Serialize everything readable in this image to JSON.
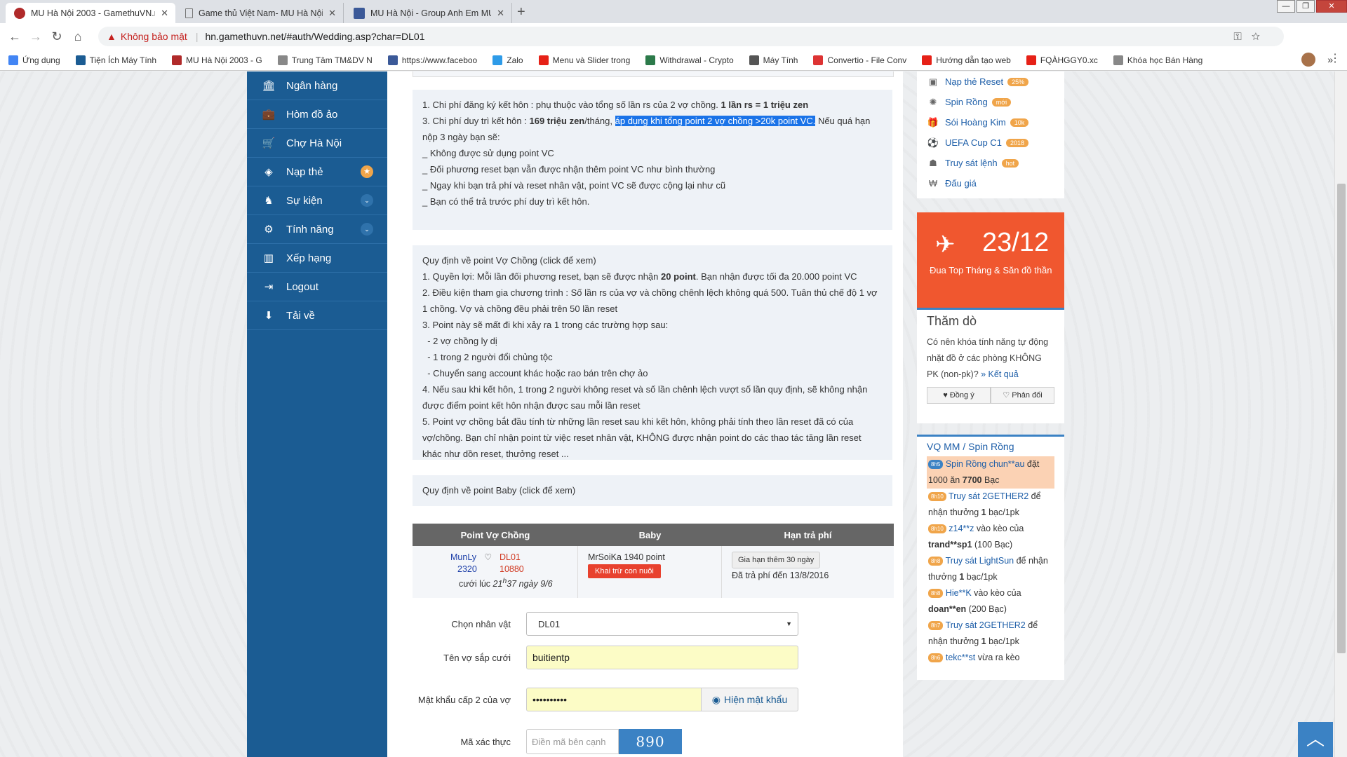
{
  "tabs": [
    {
      "title": "MU Hà Nội 2003 - GamethuVN.n"
    },
    {
      "title": "Game thủ Việt Nam- MU Hà Nội"
    },
    {
      "title": "MU Hà Nội - Group Anh Em MU"
    }
  ],
  "window_controls": [
    "—",
    "❐",
    "✕"
  ],
  "omnibox": {
    "warning": "Không bảo mật",
    "url": "hn.gamethuvn.net/#auth/Wedding.asp?char=DL01"
  },
  "bookmarks": [
    {
      "label": "Ứng dụng",
      "color": "#4285f4"
    },
    {
      "label": "Tiện Ích Máy Tính",
      "color": "#1b5c93"
    },
    {
      "label": "MU Hà Nội 2003 - G",
      "color": "#b02a2a"
    },
    {
      "label": "Trung Tâm TM&DV N",
      "color": "#888888"
    },
    {
      "label": "https://www.faceboo",
      "color": "#3b5998"
    },
    {
      "label": "Zalo",
      "color": "#2e9be8"
    },
    {
      "label": "Menu và Slider trong",
      "color": "#e62117"
    },
    {
      "label": "Withdrawal - Crypto",
      "color": "#2c7a4a"
    },
    {
      "label": "Máy Tính",
      "color": "#555555"
    },
    {
      "label": "Convertio - File Conv",
      "color": "#d33"
    },
    {
      "label": "Hướng dẫn tạo web",
      "color": "#e62117"
    },
    {
      "label": "FQÀHGGY0.xc",
      "color": "#e62117"
    },
    {
      "label": "Khóa học Bán Hàng",
      "color": "#888888"
    }
  ],
  "sidebar": [
    {
      "label": "Ngân hàng",
      "icon": "🏛"
    },
    {
      "label": "Hòm đồ ảo",
      "icon": "💼"
    },
    {
      "label": "Chợ Hà Nội",
      "icon": "🛒"
    },
    {
      "label": "Nạp thẻ",
      "icon": "◈",
      "badge": "★"
    },
    {
      "label": "Sự kiện",
      "icon": "♞",
      "chev": "⌄"
    },
    {
      "label": "Tính năng",
      "icon": "⚙",
      "chev": "⌄"
    },
    {
      "label": "Xếp hạng",
      "icon": "▥"
    },
    {
      "label": "Logout",
      "icon": "⇥"
    },
    {
      "label": "Tải về",
      "icon": "⬇"
    }
  ],
  "costs": {
    "l1_a": "1. Chi phí đăng ký kết hôn : phụ thuộc vào tổng số lần rs của 2 vợ chồng. ",
    "l1_b": "1 lần rs = 1 triệu zen",
    "l2_a": "3. Chi phí duy trì kết hôn : ",
    "l2_b": "169 triệu zen",
    "l2_c": "/tháng, ",
    "l2_hl": "áp dụng khi tổng point 2 vợ chồng >20k point VC.",
    "l2_d": " Nếu quá hạn nộp 3 ngày bạn sẽ:",
    "lines": [
      "_ Không được sử dụng point VC",
      "_ Đối phương reset bạn vẫn được nhận thêm point VC như bình thường",
      "_ Ngay khi bạn trả phí và reset nhân vật, point VC sẽ được cộng lại như cũ",
      "_ Bạn có thể trả trước phí duy trì kết hôn."
    ]
  },
  "rules": {
    "title": "Quy định về point Vợ Chồng (click để xem)",
    "r1_a": "1. Quyền lợi: Mỗi lần đối phương reset, bạn sẽ được nhận ",
    "r1_b": "20 point",
    "r1_c": ". Bạn nhận được tối đa 20.000 point VC",
    "lines": [
      "2. Điều kiện tham gia chương trình : Số lần rs của vợ và chồng chênh lệch không quá 500. Tuân thủ chế độ 1 vợ 1 chồng. Vợ và chồng đều phải trên 50 lần reset",
      "3. Point này sẽ mất đi khi xảy ra 1 trong các trường hợp sau:",
      "  - 2 vợ chồng ly dị",
      "  - 1 trong 2 người đổi chủng tộc",
      "  - Chuyển sang account khác hoặc rao bán trên chợ ảo",
      "4. Nếu sau khi kết hôn, 1 trong 2 người không reset và số lần chênh lệch vượt số lần quy định, sẽ không nhận được điểm point kết hôn nhận được sau mỗi lần reset",
      "5. Point vợ chồng bắt đầu tính từ những lần reset sau khi kết hôn, không phải tính theo lần reset đã có của vợ/chồng. Bạn chỉ nhận point từ việc reset nhân vật, KHÔNG được nhận point do các thao tác tăng lần reset khác như dồn reset, thưởng reset ..."
    ]
  },
  "baby_rules": "Quy định về point Baby (click để xem)",
  "table": {
    "headers": [
      "Point Vợ Chồng",
      "Baby",
      "Hạn trả phí"
    ],
    "husband": "MunLy",
    "husband_rs": "2320",
    "wife": "DL01",
    "wife_rs": "10880",
    "married_prefix": "cưới lúc ",
    "married_h": "21",
    "married_sup": "h",
    "married_m": "37 ngày 9/6",
    "baby": "MrSoiKa 1940 point",
    "baby_btn": "Khai trừ con nuôi",
    "extend_btn": "Gia hạn thêm 30 ngày",
    "paid": "Đã trả phí đến 13/8/2016"
  },
  "form": {
    "char_label": "Chọn nhân vật",
    "char_value": "DL01",
    "spouse_label": "Tên vợ sắp cưới",
    "spouse_value": "buitientp",
    "pwd_label": "Mật khẩu cấp 2 của vợ",
    "pwd_value": "••••••••••",
    "show_pwd": "Hiện mật khẩu",
    "captcha_label": "Mã xác thực",
    "captcha_placeholder": "Điền mã bên cạnh",
    "captcha_code": "890"
  },
  "right_links": [
    {
      "label": "Nạp thẻ Reset",
      "pill": "25%",
      "icon": "▣"
    },
    {
      "label": "Spin Rồng",
      "pill": "mới",
      "icon": "✺"
    },
    {
      "label": "Sói Hoàng Kim",
      "pill": "10k",
      "icon": "🎁"
    },
    {
      "label": "UEFA Cup C1",
      "pill": "2018",
      "icon": "⚽"
    },
    {
      "label": "Truy sát lệnh",
      "pill": "hot",
      "icon": "☗"
    },
    {
      "label": "Đấu giá",
      "pill": "",
      "icon": "₩"
    }
  ],
  "promo": {
    "date": "23/12",
    "text": "Đua Top Tháng & Săn đồ thần"
  },
  "poll": {
    "title": "Thăm dò",
    "question": "Có nên khóa tính năng tự động nhặt đồ ở các phòng KHÔNG PK (non-pk)? ",
    "result_link": "» Kết quả",
    "agree": "♥ Đồng ý",
    "disagree": "♡ Phản đối"
  },
  "feed": {
    "title": "VQ MM / Spin Rồng",
    "items": [
      {
        "tag": "8h5",
        "name": "Spin Rồng chun**au",
        "text": " đặt 1000 ăn ",
        "bold": "7700",
        "suffix": " Bạc"
      },
      {
        "tag": "8h10",
        "name": "Truy sát 2GETHER2",
        "text": " để nhận thưởng ",
        "bold": "1",
        "suffix": " bạc/1pk"
      },
      {
        "tag": "8h10",
        "name": "z14**z",
        "text": " vào kèo của ",
        "bold": "trand**sp1",
        "suffix": " (100 Bạc)"
      },
      {
        "tag": "8h8",
        "name": "Truy sát LightSun",
        "text": " để nhận thưởng ",
        "bold": "1",
        "suffix": " bạc/1pk"
      },
      {
        "tag": "8h8",
        "name": "Hie**K",
        "text": " vào kèo của ",
        "bold": "doan**en",
        "suffix": " (200 Bạc)"
      },
      {
        "tag": "8h7",
        "name": "Truy sát 2GETHER2",
        "text": " để nhận thưởng ",
        "bold": "1",
        "suffix": " bạc/1pk"
      },
      {
        "tag": "8h6",
        "name": "tekc**st",
        "text": " vừa ra kèo",
        "bold": "",
        "suffix": ""
      }
    ]
  },
  "to_top": "︿"
}
